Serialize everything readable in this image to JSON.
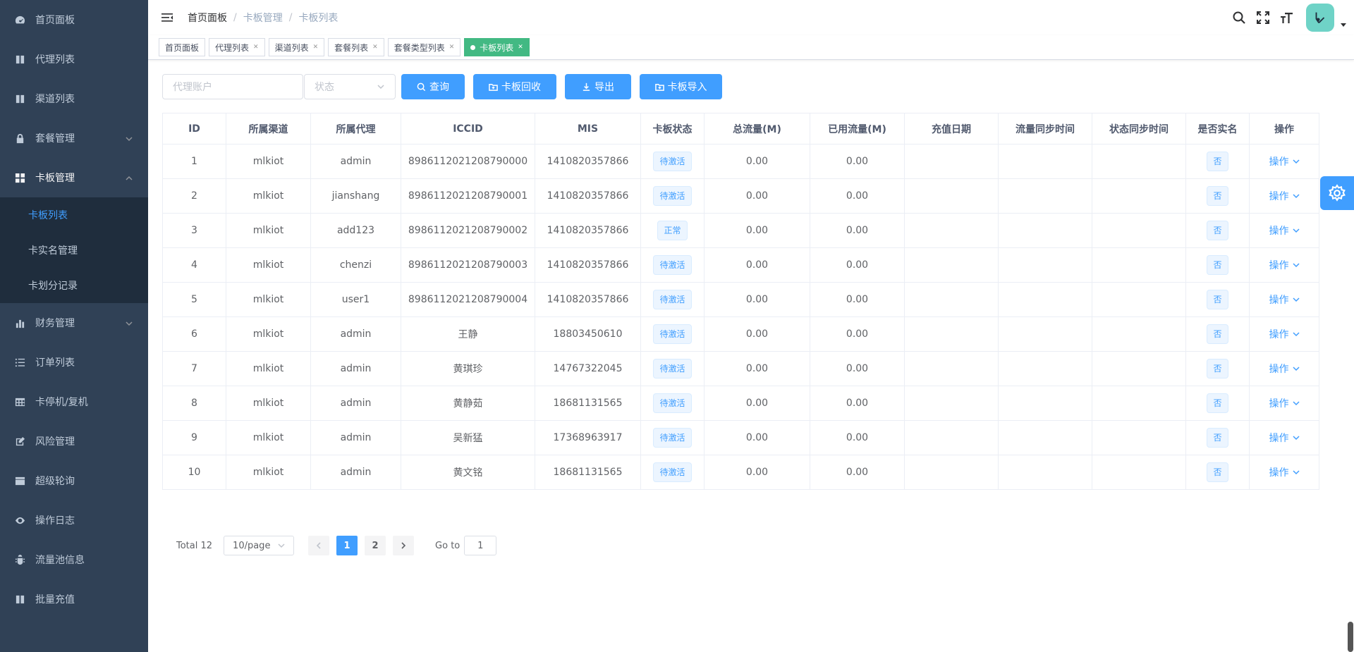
{
  "sidebar": {
    "items": [
      {
        "label": "首页面板",
        "icon": "dashboard-icon"
      },
      {
        "label": "代理列表",
        "icon": "book-icon"
      },
      {
        "label": "渠道列表",
        "icon": "book-icon"
      },
      {
        "label": "套餐管理",
        "icon": "lock-icon"
      },
      {
        "label": "卡板管理",
        "icon": "grid-icon"
      },
      {
        "label": "财务管理",
        "icon": "chart-icon"
      },
      {
        "label": "订单列表",
        "icon": "list-icon"
      },
      {
        "label": "卡停机/复机",
        "icon": "table-icon"
      },
      {
        "label": "风险管理",
        "icon": "edit-icon"
      },
      {
        "label": "超级轮询",
        "icon": "clapper-icon"
      },
      {
        "label": "操作日志",
        "icon": "eye-icon"
      },
      {
        "label": "流量池信息",
        "icon": "bug-icon"
      },
      {
        "label": "批量充值",
        "icon": "book-icon"
      }
    ],
    "submenu": [
      {
        "label": "卡板列表"
      },
      {
        "label": "卡实名管理"
      },
      {
        "label": "卡划分记录"
      }
    ]
  },
  "breadcrumb": [
    "首页面板",
    "卡板管理",
    "卡板列表"
  ],
  "tags": [
    {
      "label": "首页面板"
    },
    {
      "label": "代理列表"
    },
    {
      "label": "渠道列表"
    },
    {
      "label": "套餐列表"
    },
    {
      "label": "套餐类型列表"
    },
    {
      "label": "卡板列表"
    }
  ],
  "filters": {
    "agent_placeholder": "代理账户",
    "status_placeholder": "状态",
    "query": "查询",
    "recycle": "卡板回收",
    "export": "导出",
    "import": "卡板导入"
  },
  "table": {
    "headers": [
      "ID",
      "所属渠道",
      "所属代理",
      "ICCID",
      "MIS",
      "卡板状态",
      "总流量(M)",
      "已用流量(M)",
      "充值日期",
      "流量同步时间",
      "状态同步时间",
      "是否实名",
      "操作"
    ],
    "rows": [
      [
        "1",
        "mlkiot",
        "admin",
        "8986112021208790000",
        "1410820357866",
        "待激活",
        "0.00",
        "0.00",
        "",
        "",
        "",
        "否",
        "操作"
      ],
      [
        "2",
        "mlkiot",
        "jianshang",
        "8986112021208790001",
        "1410820357866",
        "待激活",
        "0.00",
        "0.00",
        "",
        "",
        "",
        "否",
        "操作"
      ],
      [
        "3",
        "mlkiot",
        "add123",
        "8986112021208790002",
        "1410820357866",
        "正常",
        "0.00",
        "0.00",
        "",
        "",
        "",
        "否",
        "操作"
      ],
      [
        "4",
        "mlkiot",
        "chenzi",
        "8986112021208790003",
        "1410820357866",
        "待激活",
        "0.00",
        "0.00",
        "",
        "",
        "",
        "否",
        "操作"
      ],
      [
        "5",
        "mlkiot",
        "user1",
        "8986112021208790004",
        "1410820357866",
        "待激活",
        "0.00",
        "0.00",
        "",
        "",
        "",
        "否",
        "操作"
      ],
      [
        "6",
        "mlkiot",
        "admin",
        "王静",
        "18803450610",
        "待激活",
        "0.00",
        "0.00",
        "",
        "",
        "",
        "否",
        "操作"
      ],
      [
        "7",
        "mlkiot",
        "admin",
        "黄琪珍",
        "14767322045",
        "待激活",
        "0.00",
        "0.00",
        "",
        "",
        "",
        "否",
        "操作"
      ],
      [
        "8",
        "mlkiot",
        "admin",
        "黄静茹",
        "18681131565",
        "待激活",
        "0.00",
        "0.00",
        "",
        "",
        "",
        "否",
        "操作"
      ],
      [
        "9",
        "mlkiot",
        "admin",
        "吴新猛",
        "17368963917",
        "待激活",
        "0.00",
        "0.00",
        "",
        "",
        "",
        "否",
        "操作"
      ],
      [
        "10",
        "mlkiot",
        "admin",
        "黄文铭",
        "18681131565",
        "待激活",
        "0.00",
        "0.00",
        "",
        "",
        "",
        "否",
        "操作"
      ]
    ]
  },
  "pagination": {
    "total": "Total 12",
    "page_size": "10/page",
    "pages": [
      "1",
      "2"
    ],
    "current": "1",
    "goto_label": "Go to",
    "goto_value": "1"
  },
  "colors": {
    "sidebar_bg": "#304156",
    "primary": "#409eff",
    "active_tag": "#42b983",
    "avatar": "#6fd3c7"
  }
}
